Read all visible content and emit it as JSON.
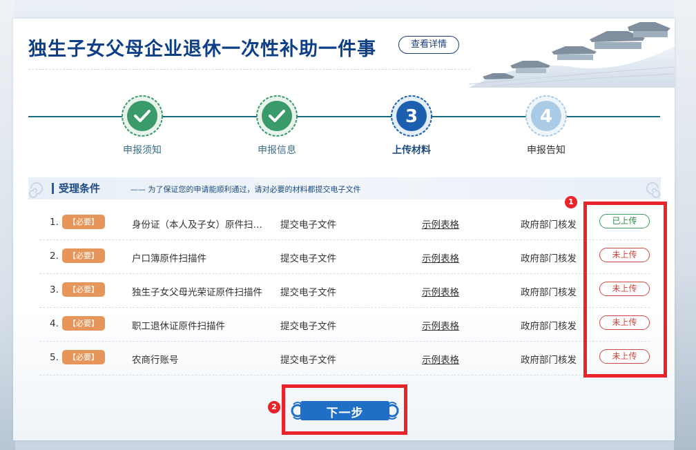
{
  "header": {
    "title": "独生子女父母企业退休一次性补助一件事",
    "detail_label": "查看详情"
  },
  "steps": [
    {
      "num": "",
      "label": "申报须知",
      "state": "done"
    },
    {
      "num": "",
      "label": "申报信息",
      "state": "done"
    },
    {
      "num": "3",
      "label": "上传材料",
      "state": "active"
    },
    {
      "num": "4",
      "label": "申报告知",
      "state": "pending"
    }
  ],
  "section": {
    "title": "受理条件",
    "note": "—— 为了保证您的申请能顺利通过，请对必要的材料都提交电子文件"
  },
  "materials": [
    {
      "index": "1.",
      "required": "【必要】",
      "name": "身份证（本人及子女）原件扫…",
      "type": "提交电子文件",
      "sample": "示例表格",
      "verify": "政府部门核发",
      "status": "已上传"
    },
    {
      "index": "2.",
      "required": "【必要】",
      "name": "户口簿原件扫描件",
      "type": "提交电子文件",
      "sample": "示例表格",
      "verify": "政府部门核发",
      "status": "未上传"
    },
    {
      "index": "3.",
      "required": "【必要】",
      "name": "独生子女父母光荣证原件扫描件",
      "type": "提交电子文件",
      "sample": "示例表格",
      "verify": "政府部门核发",
      "status": "未上传"
    },
    {
      "index": "4.",
      "required": "【必要】",
      "name": "职工退休证原件扫描件",
      "type": "提交电子文件",
      "sample": "示例表格",
      "verify": "政府部门核发",
      "status": "未上传"
    },
    {
      "index": "5.",
      "required": "【必要】",
      "name": "农商行账号",
      "type": "提交电子文件",
      "sample": "示例表格",
      "verify": "政府部门核发",
      "status": "未上传"
    }
  ],
  "next_button": {
    "label": "下一步"
  },
  "annotations": {
    "badge1": "1",
    "badge2": "2"
  },
  "colors": {
    "title": "#0d3f86",
    "step_done": "#3a9a6a",
    "step_active": "#1b5fae",
    "step_pending": "#a9cbe6",
    "required_badge": "#e6965a",
    "status_done": "#3a9a5a",
    "status_todo": "#c94a42",
    "highlight": "#e8242a",
    "next_button": "#1f6fc6"
  },
  "icons": {
    "check": "check-icon",
    "ornament": "cloud-ornament-icon"
  }
}
